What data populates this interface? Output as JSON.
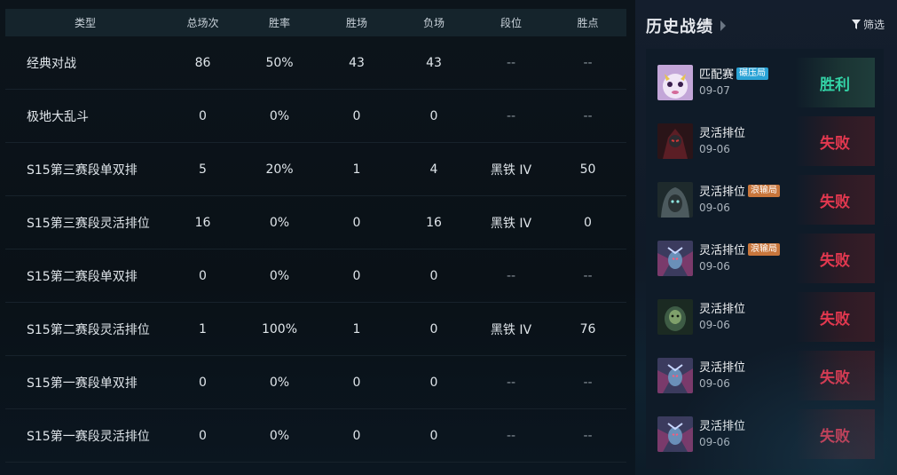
{
  "stats": {
    "headers": {
      "type": "类型",
      "total": "总场次",
      "rate": "胜率",
      "win": "胜场",
      "loss": "负场",
      "tier": "段位",
      "lp": "胜点"
    },
    "rows": [
      {
        "type": "经典对战",
        "total": "86",
        "rate": "50%",
        "win": "43",
        "loss": "43",
        "tier": "--",
        "lp": "--"
      },
      {
        "type": "极地大乱斗",
        "total": "0",
        "rate": "0%",
        "win": "0",
        "loss": "0",
        "tier": "--",
        "lp": "--"
      },
      {
        "type": "S15第三赛段单双排",
        "total": "5",
        "rate": "20%",
        "win": "1",
        "loss": "4",
        "tier": "黑铁 IV",
        "lp": "50"
      },
      {
        "type": "S15第三赛段灵活排位",
        "total": "16",
        "rate": "0%",
        "win": "0",
        "loss": "16",
        "tier": "黑铁 IV",
        "lp": "0"
      },
      {
        "type": "S15第二赛段单双排",
        "total": "0",
        "rate": "0%",
        "win": "0",
        "loss": "0",
        "tier": "--",
        "lp": "--"
      },
      {
        "type": "S15第二赛段灵活排位",
        "total": "1",
        "rate": "100%",
        "win": "1",
        "loss": "0",
        "tier": "黑铁 IV",
        "lp": "76"
      },
      {
        "type": "S15第一赛段单双排",
        "total": "0",
        "rate": "0%",
        "win": "0",
        "loss": "0",
        "tier": "--",
        "lp": "--"
      },
      {
        "type": "S15第一赛段灵活排位",
        "total": "0",
        "rate": "0%",
        "win": "0",
        "loss": "0",
        "tier": "--",
        "lp": "--"
      }
    ]
  },
  "history": {
    "title": "历史战绩",
    "filter_label": "筛选",
    "matches": [
      {
        "mode": "匹配赛",
        "badge": "碾压局",
        "badge_color": "#2aa3d6",
        "date": "09-07",
        "result": "胜利",
        "outcome": "win",
        "avatar": "poro-champion-avatar"
      },
      {
        "mode": "灵活排位",
        "badge": "",
        "date": "09-06",
        "result": "失败",
        "outcome": "loss",
        "avatar": "dark-knight-champion-avatar"
      },
      {
        "mode": "灵活排位",
        "badge": "浪输局",
        "badge_color": "#c8763c",
        "date": "09-06",
        "result": "失败",
        "outcome": "loss",
        "avatar": "hooded-champion-avatar"
      },
      {
        "mode": "灵活排位",
        "badge": "浪输局",
        "badge_color": "#c8763c",
        "date": "09-06",
        "result": "失败",
        "outcome": "loss",
        "avatar": "winged-champion-avatar"
      },
      {
        "mode": "灵活排位",
        "badge": "",
        "date": "09-06",
        "result": "失败",
        "outcome": "loss",
        "avatar": "green-champion-avatar"
      },
      {
        "mode": "灵活排位",
        "badge": "",
        "date": "09-06",
        "result": "失败",
        "outcome": "loss",
        "avatar": "winged-champion-avatar"
      },
      {
        "mode": "灵活排位",
        "badge": "",
        "date": "09-06",
        "result": "失败",
        "outcome": "loss",
        "avatar": "winged-champion-avatar"
      }
    ]
  },
  "colors": {
    "win": "#33d3a6",
    "loss": "#e2384f",
    "header_bg": "#15242c"
  }
}
